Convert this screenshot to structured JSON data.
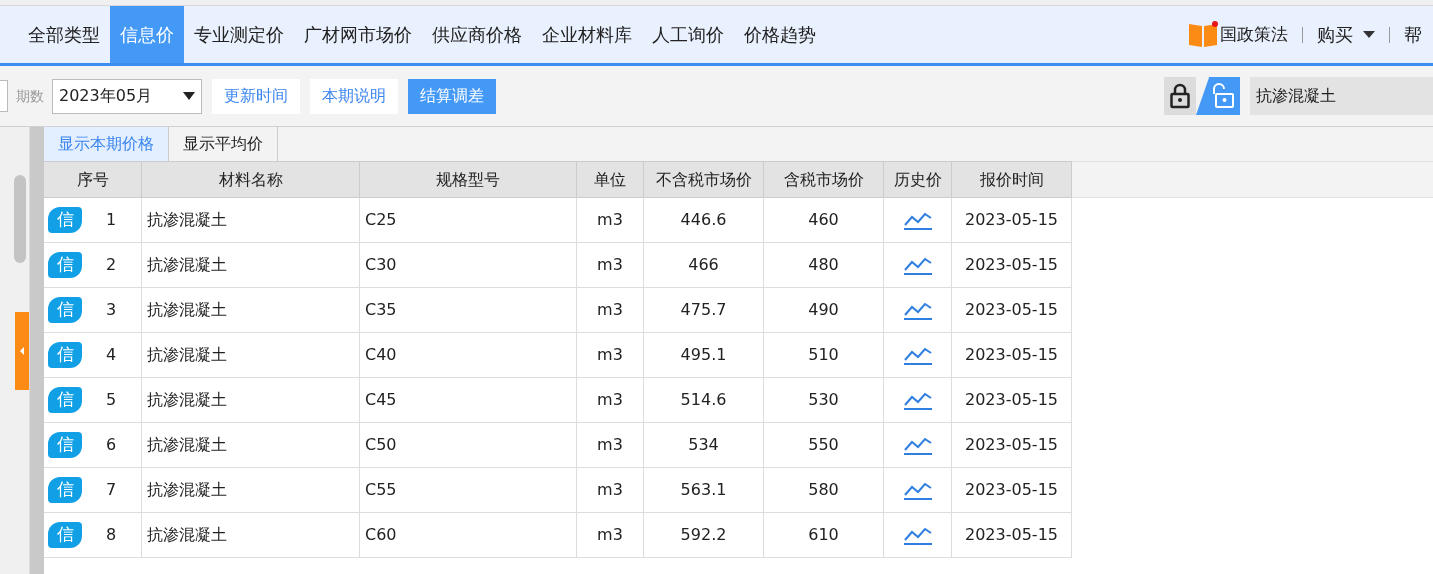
{
  "nav_tabs": [
    {
      "label": "全部类型",
      "selected": false
    },
    {
      "label": "信息价",
      "selected": true
    },
    {
      "label": "专业测定价",
      "selected": false
    },
    {
      "label": "广材网市场价",
      "selected": false
    },
    {
      "label": "供应商价格",
      "selected": false
    },
    {
      "label": "企业材料库",
      "selected": false
    },
    {
      "label": "人工询价",
      "selected": false
    },
    {
      "label": "价格趋势",
      "selected": false
    }
  ],
  "nav_right": {
    "policy_link": "国政策法",
    "buy_menu": "购买",
    "help": "帮"
  },
  "toolbar": {
    "period_label": "期数",
    "period_value": "2023年05月",
    "buttons": [
      {
        "label": "更新时间",
        "selected": false
      },
      {
        "label": "本期说明",
        "selected": false
      },
      {
        "label": "结算调差",
        "selected": true
      }
    ],
    "lock_buttons": [
      {
        "kind": "lock",
        "selected": false
      },
      {
        "kind": "unlock",
        "selected": true
      }
    ],
    "search_value": "抗渗混凝土"
  },
  "view_tabs": [
    {
      "label": "显示本期价格",
      "selected": true
    },
    {
      "label": "显示平均价",
      "selected": false
    }
  ],
  "table": {
    "columns": [
      "序号",
      "材料名称",
      "规格型号",
      "单位",
      "不含税市场价",
      "含税市场价",
      "历史价",
      "报价时间"
    ],
    "rows": [
      {
        "tag": "信",
        "index": "1",
        "name": "抗渗混凝土",
        "spec": "C25",
        "unit": "m3",
        "price_ex_tax": "446.6",
        "price_inc_tax": "460",
        "date": "2023-05-15"
      },
      {
        "tag": "信",
        "index": "2",
        "name": "抗渗混凝土",
        "spec": "C30",
        "unit": "m3",
        "price_ex_tax": "466",
        "price_inc_tax": "480",
        "date": "2023-05-15"
      },
      {
        "tag": "信",
        "index": "3",
        "name": "抗渗混凝土",
        "spec": "C35",
        "unit": "m3",
        "price_ex_tax": "475.7",
        "price_inc_tax": "490",
        "date": "2023-05-15"
      },
      {
        "tag": "信",
        "index": "4",
        "name": "抗渗混凝土",
        "spec": "C40",
        "unit": "m3",
        "price_ex_tax": "495.1",
        "price_inc_tax": "510",
        "date": "2023-05-15"
      },
      {
        "tag": "信",
        "index": "5",
        "name": "抗渗混凝土",
        "spec": "C45",
        "unit": "m3",
        "price_ex_tax": "514.6",
        "price_inc_tax": "530",
        "date": "2023-05-15"
      },
      {
        "tag": "信",
        "index": "6",
        "name": "抗渗混凝土",
        "spec": "C50",
        "unit": "m3",
        "price_ex_tax": "534",
        "price_inc_tax": "550",
        "date": "2023-05-15"
      },
      {
        "tag": "信",
        "index": "7",
        "name": "抗渗混凝土",
        "spec": "C55",
        "unit": "m3",
        "price_ex_tax": "563.1",
        "price_inc_tax": "580",
        "date": "2023-05-15"
      },
      {
        "tag": "信",
        "index": "8",
        "name": "抗渗混凝土",
        "spec": "C60",
        "unit": "m3",
        "price_ex_tax": "592.2",
        "price_inc_tax": "610",
        "date": "2023-05-15"
      }
    ]
  }
}
